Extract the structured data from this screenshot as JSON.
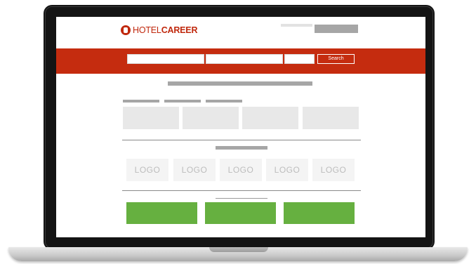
{
  "brand": {
    "name_light": "HOTEL",
    "name_bold": "CAREER",
    "color": "#c52c0f"
  },
  "search": {
    "button_label": "Search"
  },
  "logo_row": {
    "items": [
      "LOGO",
      "LOGO",
      "LOGO",
      "LOGO",
      "LOGO"
    ]
  },
  "colors": {
    "accent": "#c52c0f",
    "cta_green": "#66b040",
    "placeholder_grey": "#a6a6a6",
    "card_grey": "#e8e8e8"
  }
}
